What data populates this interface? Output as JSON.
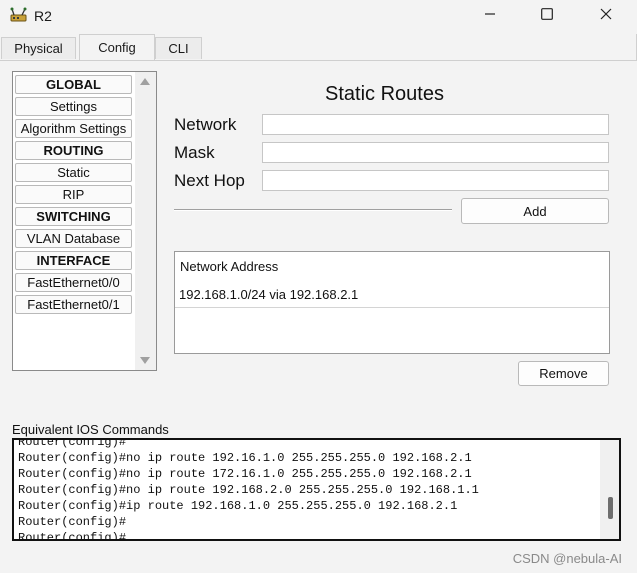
{
  "window": {
    "title": "R2",
    "icon": "router-icon"
  },
  "window_controls": [
    "minimize-icon",
    "maximize-icon",
    "close-icon"
  ],
  "tabs": [
    {
      "label": "Physical",
      "active": false
    },
    {
      "label": "Config",
      "active": true
    },
    {
      "label": "CLI",
      "active": false
    }
  ],
  "sidebar": {
    "items": [
      {
        "label": "GLOBAL",
        "header": true
      },
      {
        "label": "Settings",
        "header": false
      },
      {
        "label": "Algorithm Settings",
        "header": false
      },
      {
        "label": "ROUTING",
        "header": true
      },
      {
        "label": "Static",
        "header": false
      },
      {
        "label": "RIP",
        "header": false
      },
      {
        "label": "SWITCHING",
        "header": true
      },
      {
        "label": "VLAN Database",
        "header": false
      },
      {
        "label": "INTERFACE",
        "header": true
      },
      {
        "label": "FastEthernet0/0",
        "header": false
      },
      {
        "label": "FastEthernet0/1",
        "header": false
      }
    ]
  },
  "static_routes": {
    "heading": "Static Routes",
    "network_label": "Network",
    "network_value": "",
    "mask_label": "Mask",
    "mask_value": "",
    "nexthop_label": "Next Hop",
    "nexthop_value": "",
    "add_label": "Add",
    "list_header": "Network Address",
    "entries": [
      "192.168.1.0/24 via 192.168.2.1"
    ],
    "remove_label": "Remove"
  },
  "ios": {
    "label": "Equivalent IOS Commands",
    "lines": [
      "Router(config)#",
      "Router(config)#no ip route 192.16.1.0 255.255.255.0 192.168.2.1",
      "Router(config)#no ip route 172.16.1.0 255.255.255.0 192.168.2.1",
      "Router(config)#no ip route 192.168.2.0 255.255.255.0 192.168.1.1",
      "Router(config)#ip route 192.168.1.0 255.255.255.0 192.168.2.1",
      "Router(config)#",
      "Router(config)#"
    ]
  },
  "watermark": "CSDN @nebula-AI"
}
